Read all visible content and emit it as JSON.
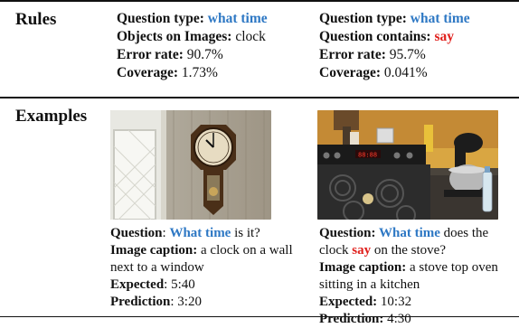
{
  "header": {
    "rules_label": "Rules",
    "examples_label": "Examples"
  },
  "rules": [
    {
      "line1_label": "Question type: ",
      "line1_value": "what time",
      "line2_label": "Objects on Images: ",
      "line2_value": "clock",
      "error_label": "Error rate: ",
      "error_value": "90.7%",
      "coverage_label": "Coverage: ",
      "coverage_value": "1.73%"
    },
    {
      "line1_label": "Question type: ",
      "line1_value": "what time",
      "line2_label": "Question contains: ",
      "line2_value": "say",
      "error_label": "Error rate: ",
      "error_value": "95.7%",
      "coverage_label": "Coverage: ",
      "coverage_value": "0.041%"
    }
  ],
  "examples": [
    {
      "question_label": "Question",
      "question_sep": ": ",
      "question_highlight": "What time",
      "question_rest": " is it?",
      "caption_label": "Image caption:",
      "caption_text_a": " a clock on a wall",
      "caption_text_b": "next to a window",
      "expected_label": "Expected",
      "expected_value": ": 5:40",
      "prediction_label": "Prediction",
      "prediction_value": ": 3:20"
    },
    {
      "question_label": "Question: ",
      "question_highlight": "What time",
      "question_rest": " does the",
      "question_line2_a": "clock ",
      "question_line2_highlight": "say",
      "question_line2_b": " on the stove?",
      "caption_label": "Image caption:",
      "caption_text_a": " a stove top oven",
      "caption_text_b": "sitting in a kitchen",
      "expected_label": "Expected:",
      "expected_value": " 10:32",
      "prediction_label": "Prediction:",
      "prediction_value": " 4:30"
    }
  ],
  "colors": {
    "blue": "#2e78c4",
    "red": "#e0201c"
  }
}
